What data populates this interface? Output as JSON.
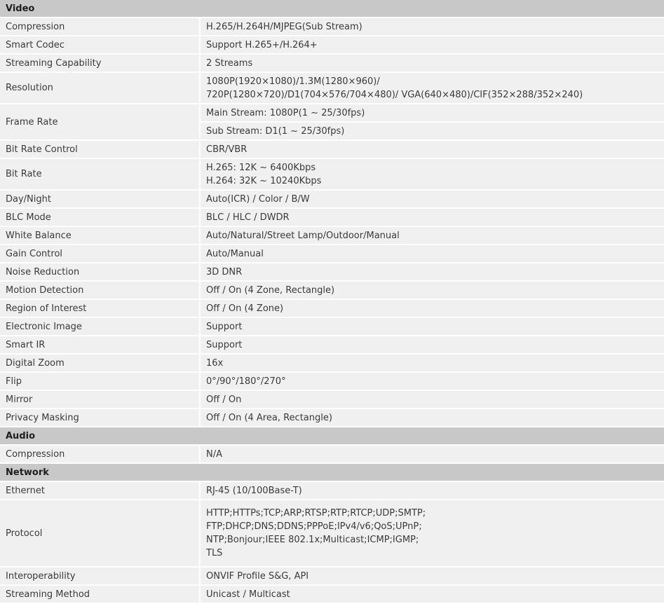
{
  "sections": {
    "video": "Video",
    "audio": "Audio",
    "network": "Network"
  },
  "video": {
    "compression": {
      "label": "Compression",
      "value": "H.265/H.264H/MJPEG(Sub Stream)"
    },
    "smart_codec": {
      "label": "Smart Codec",
      "value": "Support H.265+/H.264+"
    },
    "streaming_capability": {
      "label": "Streaming Capability",
      "value": "2 Streams"
    },
    "resolution": {
      "label": "Resolution",
      "lines": [
        "1080P(1920×1080)/1.3M(1280×960)/",
        "720P(1280×720)/D1(704×576/704×480)/ VGA(640×480)/CIF(352×288/352×240)"
      ]
    },
    "frame_rate": {
      "label": "Frame Rate",
      "main": "Main Stream: 1080P(1 ~ 25/30fps)",
      "sub": "Sub Stream: D1(1 ~ 25/30fps)"
    },
    "bit_rate_control": {
      "label": "Bit Rate Control",
      "value": "CBR/VBR"
    },
    "bit_rate": {
      "label": "Bit Rate",
      "lines": [
        "H.265: 12K ~ 6400Kbps",
        "H.264: 32K ~ 10240Kbps"
      ]
    },
    "day_night": {
      "label": "Day/Night",
      "value": "Auto(ICR) / Color / B/W"
    },
    "blc_mode": {
      "label": "BLC Mode",
      "value": "BLC / HLC / DWDR"
    },
    "white_balance": {
      "label": "White Balance",
      "value": "Auto/Natural/Street Lamp/Outdoor/Manual"
    },
    "gain_control": {
      "label": "Gain Control",
      "value": "Auto/Manual"
    },
    "noise_reduction": {
      "label": "Noise Reduction",
      "value": "3D DNR"
    },
    "motion_detection": {
      "label": "Motion Detection",
      "value": "Off / On (4 Zone, Rectangle)"
    },
    "region_of_interest": {
      "label": "Region of Interest",
      "value": "Off / On (4 Zone)"
    },
    "electronic_image": {
      "label": "Electronic Image",
      "value": "Support"
    },
    "smart_ir": {
      "label": "Smart IR",
      "value": "Support"
    },
    "digital_zoom": {
      "label": "Digital Zoom",
      "value": "16x"
    },
    "flip": {
      "label": "Flip",
      "value": "0°/90°/180°/270°"
    },
    "mirror": {
      "label": "Mirror",
      "value": "Off / On"
    },
    "privacy_masking": {
      "label": "Privacy Masking",
      "value": "Off / On (4 Area, Rectangle)"
    }
  },
  "audio": {
    "compression": {
      "label": "Compression",
      "value": "N/A"
    }
  },
  "network": {
    "ethernet": {
      "label": "Ethernet",
      "value": "RJ-45 (10/100Base-T)"
    },
    "protocol": {
      "label": "Protocol",
      "lines": [
        "HTTP;HTTPs;TCP;ARP;RTSP;RTP;RTCP;UDP;SMTP;",
        "FTP;DHCP;DNS;DDNS;PPPoE;IPv4/v6;QoS;UPnP;",
        "NTP;Bonjour;IEEE 802.1x;Multicast;ICMP;IGMP;",
        "TLS"
      ]
    },
    "interoperability": {
      "label": "Interoperability",
      "value": "ONVIF Profile S&G, API"
    },
    "streaming_method": {
      "label": "Streaming Method",
      "value": "Unicast / Multicast"
    }
  }
}
